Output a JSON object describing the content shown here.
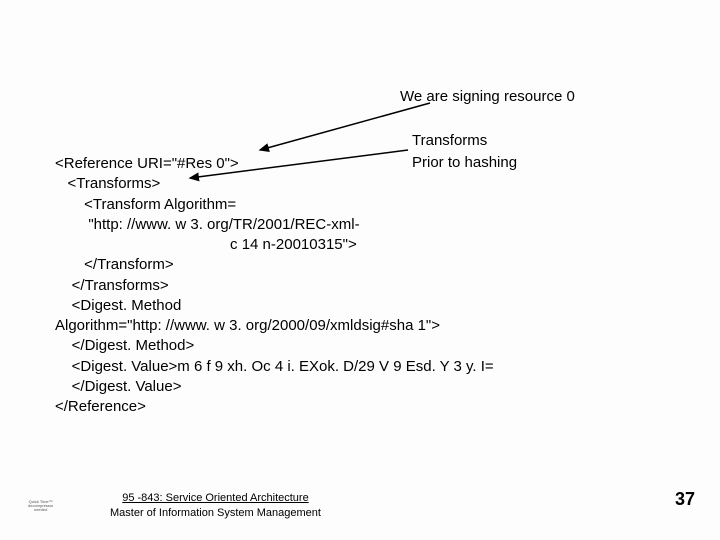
{
  "annotations": {
    "signing": "We are signing resource 0",
    "transforms": "Transforms",
    "prior": "Prior to hashing"
  },
  "code": {
    "l1": "<Reference URI=\"#Res 0\">",
    "l2": "   <Transforms>",
    "l3": "       <Transform Algorithm=",
    "l4": "        \"http: //www. w 3. org/TR/2001/REC-xml-",
    "l5": "                                          c 14 n-20010315\">",
    "l6": "       </Transform>",
    "l7": "    </Transforms>",
    "l8": "    <Digest. Method",
    "l9": "Algorithm=\"http: //www. w 3. org/2000/09/xmldsig#sha 1\">",
    "l10": "    </Digest. Method>",
    "l11": "    <Digest. Value>m 6 f 9 xh. Oc 4 i. EXok. D/29 V 9 Esd. Y 3 y. I=",
    "l12": "    </Digest. Value>",
    "l13": "</Reference>"
  },
  "footer": {
    "course": "95 -843: Service Oriented Architecture",
    "dept": "Master of Information System\nManagement"
  },
  "slide_number": "37"
}
